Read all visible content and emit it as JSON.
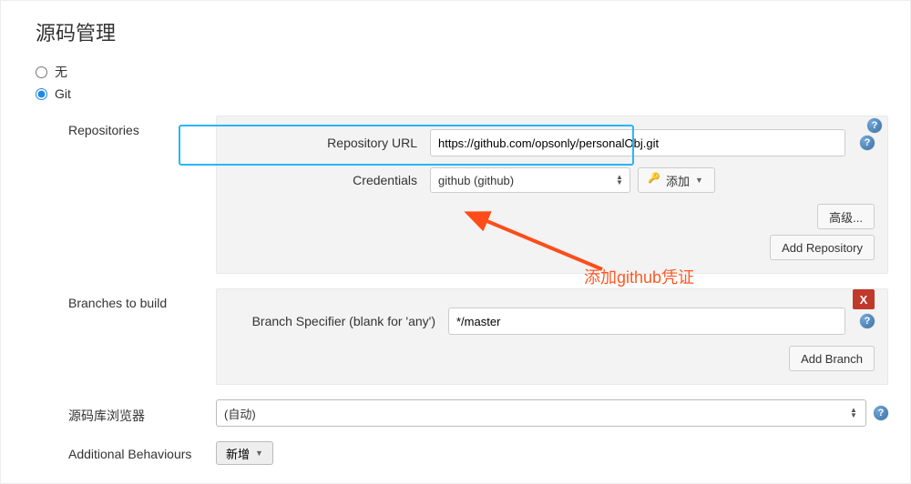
{
  "section_title": "源码管理",
  "scm": {
    "none_label": "无",
    "git_label": "Git"
  },
  "repos": {
    "label": "Repositories",
    "url_label": "Repository URL",
    "url_value": "https://github.com/opsonly/personalObj.git",
    "cred_label": "Credentials",
    "cred_value": "github (github)",
    "add_cred_btn": "添加",
    "advanced_btn": "高级...",
    "add_repo_btn": "Add Repository"
  },
  "branches": {
    "label": "Branches to build",
    "spec_label": "Branch Specifier (blank for 'any')",
    "spec_value": "*/master",
    "add_branch_btn": "Add Branch"
  },
  "browser": {
    "label": "源码库浏览器",
    "value": "(自动)"
  },
  "behaviours": {
    "label": "Additional Behaviours",
    "add_btn": "新增"
  },
  "annotation": {
    "text": "添加github凭证"
  }
}
